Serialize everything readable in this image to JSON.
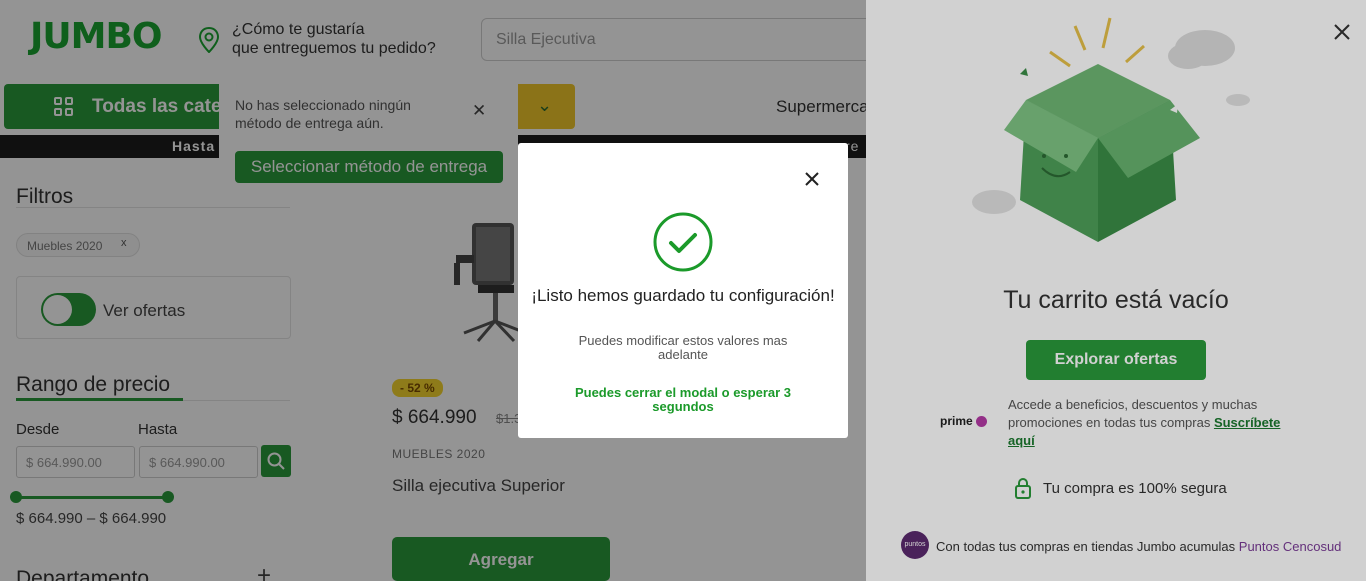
{
  "header": {
    "logo": "JUMBO",
    "delivery_prompt_line1": "¿Cómo te gustaría",
    "delivery_prompt_line2": "que entreguemos tu pedido?",
    "search_value": "Silla Ejecutiva"
  },
  "nav": {
    "categories_label": "Todas las categ",
    "supermarket_label": "Supermerca",
    "promo_text": "Hasta",
    "promo_tail": "re"
  },
  "delivery_popup": {
    "text": "No has seleccionado ningún método de entrega aún.",
    "button": "Seleccionar método de entrega"
  },
  "filters": {
    "title": "Filtros",
    "chip_label": "Muebles 2020",
    "chip_close": "x",
    "offers_label": "Ver ofertas",
    "price_range_title": "Rango de precio",
    "from_label": "Desde",
    "to_label": "Hasta",
    "from_placeholder": "$ 664.990.00",
    "to_placeholder": "$ 664.990.00",
    "range_value": "$ 664.990 – $ 664.990",
    "department_title": "Departamento",
    "department_toggle": "+"
  },
  "product": {
    "discount": "- 52 %",
    "price": "$ 664.990",
    "old_price": "$1.3",
    "brand": "MUEBLES 2020",
    "name": "Silla ejecutiva Superior",
    "add_button": "Agregar"
  },
  "cart": {
    "title": "Tu carrito está vacío",
    "explore_button": "Explorar ofertas",
    "prime_logo": "prime",
    "prime_text": "Accede a beneficios, descuentos y muchas promociones en todas tus compras ",
    "prime_link": "Suscríbete aquí",
    "secure_text": "Tu compra es 100% segura",
    "puntos_logo": "puntos",
    "puntos_text": "Con todas tus compras en tiendas Jumbo acumulas ",
    "puntos_link": "Puntos Cencosud"
  },
  "modal": {
    "title": "¡Listo hemos guardado tu configuración!",
    "subtitle": "Puedes modificar estos valores mas adelante",
    "note": "Puedes cerrar el modal o esperar 3 segundos"
  },
  "colors": {
    "brand_green": "#2a9a3b",
    "promo_yellow": "#f0c62a",
    "success_green": "#1b9a2a"
  }
}
